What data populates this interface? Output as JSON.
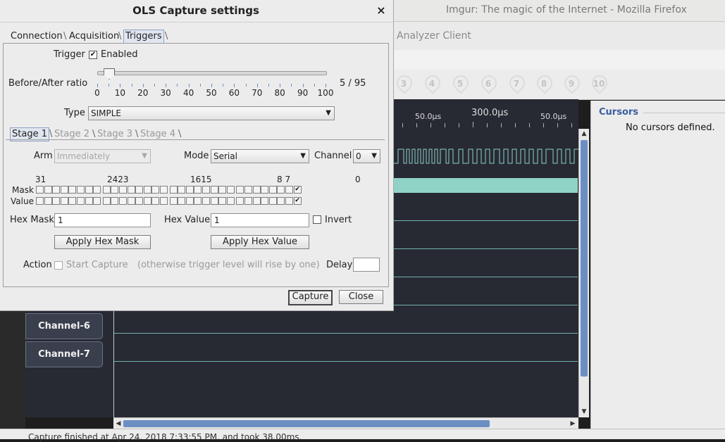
{
  "background": {
    "firefox_title": "Imgur: The magic of the Internet - Mozilla Firefox",
    "app_title": "Analyzer Client",
    "toolbar_numbers": [
      "3",
      "4",
      "5",
      "6",
      "7",
      "8",
      "9",
      "10"
    ],
    "ruler": {
      "left": "50.0µs",
      "center": "300.0µs",
      "right": "50.0µs"
    },
    "channels": [
      "Channel-6",
      "Channel-7"
    ],
    "status": "Capture finished at Apr 24, 2018 7:33:55 PM, and took 38.00ms.",
    "cursors": {
      "title": "Cursors",
      "empty": "No cursors defined."
    }
  },
  "dialog": {
    "title": "OLS Capture settings",
    "close_glyph": "×",
    "tabs": [
      {
        "label": "Connection",
        "active": false
      },
      {
        "label": "Acquisition",
        "active": false
      },
      {
        "label": "Triggers",
        "active": true
      }
    ],
    "trigger": {
      "label": "Trigger",
      "enabled_label": "Enabled",
      "enabled": true
    },
    "ratio": {
      "label": "Before/After ratio",
      "value_text": "5 / 95",
      "value": 5,
      "ticks": [
        "0",
        "10",
        "20",
        "30",
        "40",
        "50",
        "60",
        "70",
        "80",
        "90",
        "100"
      ]
    },
    "type": {
      "label": "Type",
      "value": "SIMPLE"
    },
    "stage_tabs": [
      {
        "label": "Stage 1",
        "active": true
      },
      {
        "label": "Stage 2",
        "active": false
      },
      {
        "label": "Stage 3",
        "active": false
      },
      {
        "label": "Stage 4",
        "active": false
      }
    ],
    "arm": {
      "label": "Arm",
      "value": "Immediately"
    },
    "mode": {
      "label": "Mode",
      "value": "Serial"
    },
    "channel": {
      "label": "Channel",
      "value": "0"
    },
    "bit_numbers": [
      "31",
      "2423",
      "1615",
      "8 7",
      "0"
    ],
    "mask_label": "Mask",
    "value_label": "Value",
    "mask_bits_checked": [
      0
    ],
    "value_bits_checked": [
      0
    ],
    "hex_mask": {
      "label": "Hex Mask",
      "value": "1"
    },
    "hex_value": {
      "label": "Hex Value",
      "value": "1"
    },
    "invert": {
      "label": "Invert",
      "checked": false
    },
    "apply_mask": "Apply Hex Mask",
    "apply_value": "Apply Hex Value",
    "action": {
      "label": "Action",
      "start_capture": "Start Capture",
      "note": "(otherwise trigger level will rise by one)"
    },
    "delay": {
      "label": "Delay",
      "value": ""
    },
    "capture_button": "Capture",
    "close_button": "Close"
  }
}
